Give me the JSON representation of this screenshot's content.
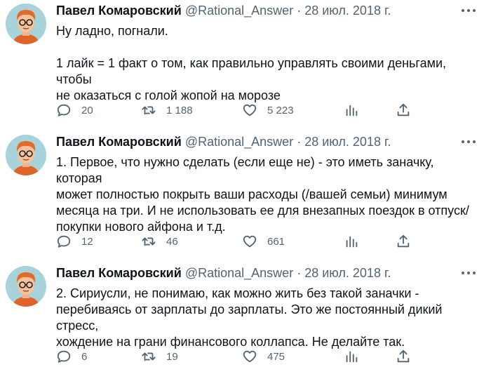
{
  "tweets": [
    {
      "author": {
        "name": "Павел Комаровский",
        "handle": "@Rational_Answer"
      },
      "separator": "·",
      "date": "28 июл. 2018 г.",
      "lines": [
        "Ну ладно, погнали.",
        "",
        "1 лайк = 1 факт о том, как правильно управлять своими деньгами, чтобы",
        "не оказаться с голой жопой на морозе"
      ],
      "stats": {
        "replies": "20",
        "retweets": "1 188",
        "likes": "5 223"
      },
      "icons": {
        "reply": "reply-icon",
        "retweet": "retweet-icon",
        "like": "heart-icon",
        "views": "analytics-icon",
        "share": "share-icon",
        "more": "more-icon"
      }
    },
    {
      "author": {
        "name": "Павел Комаровский",
        "handle": "@Rational_Answer"
      },
      "separator": "·",
      "date": "28 июл. 2018 г.",
      "lines": [
        "1. Первое, что нужно сделать (если еще не) - это иметь заначку, которая",
        "может полностью покрыть ваши расходы (/вашей семьи) минимум",
        "месяца на три. И не использовать ее для внезапных поездок в отпуск/",
        "покупки нового айфона и т.д."
      ],
      "stats": {
        "replies": "12",
        "retweets": "46",
        "likes": "661"
      }
    },
    {
      "author": {
        "name": "Павел Комаровский",
        "handle": "@Rational_Answer"
      },
      "separator": "·",
      "date": "28 июл. 2018 г.",
      "lines": [
        "2. Сириусли, не понимаю, как можно жить без такой заначки -",
        "перебиваясь от зарплаты до зарплаты. Это же постоянный дикий стресс,",
        "хождение на грани финансового коллапса. Не делайте так."
      ],
      "stats": {
        "replies": "6",
        "retweets": "19",
        "likes": "475"
      }
    }
  ]
}
